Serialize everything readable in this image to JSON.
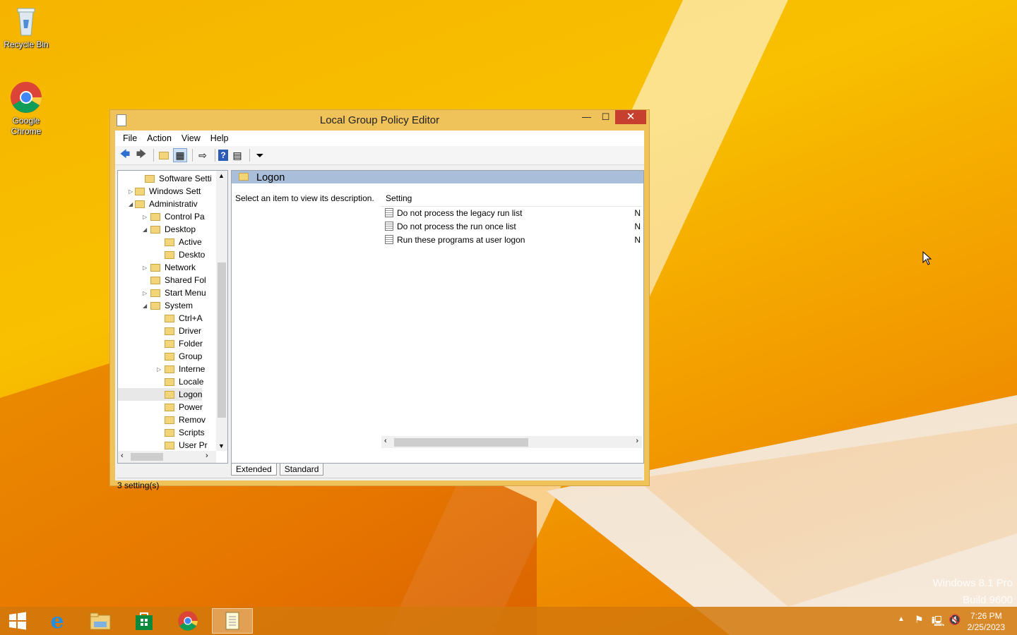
{
  "desktop": {
    "icons": [
      {
        "label": "Recycle Bin"
      },
      {
        "label": "Google Chrome"
      }
    ],
    "watermark": {
      "line1": "Windows 8.1 Pro",
      "line2": "Build 9600"
    }
  },
  "window": {
    "title": "Local Group Policy Editor",
    "menu": [
      "File",
      "Action",
      "View",
      "Help"
    ],
    "tree": [
      {
        "label": "Software Setti",
        "expander": ""
      },
      {
        "label": "Windows Sett",
        "expander": "▷"
      },
      {
        "label": "Administrativ",
        "expander": "◢"
      },
      {
        "label": "Control Pa",
        "expander": "▷"
      },
      {
        "label": "Desktop",
        "expander": "◢"
      },
      {
        "label": "Active",
        "expander": ""
      },
      {
        "label": "Deskto",
        "expander": ""
      },
      {
        "label": "Network",
        "expander": "▷"
      },
      {
        "label": "Shared Fol",
        "expander": ""
      },
      {
        "label": "Start Menu",
        "expander": "▷"
      },
      {
        "label": "System",
        "expander": "◢"
      },
      {
        "label": "Ctrl+A",
        "expander": ""
      },
      {
        "label": "Driver",
        "expander": ""
      },
      {
        "label": "Folder",
        "expander": ""
      },
      {
        "label": "Group",
        "expander": ""
      },
      {
        "label": "Interne",
        "expander": "▷"
      },
      {
        "label": "Locale",
        "expander": ""
      },
      {
        "label": "Logon",
        "expander": ""
      },
      {
        "label": "Power",
        "expander": ""
      },
      {
        "label": "Remov",
        "expander": ""
      },
      {
        "label": "Scripts",
        "expander": ""
      },
      {
        "label": "User Pr",
        "expander": ""
      }
    ],
    "detail": {
      "title": "Logon",
      "description": "Select an item to view its description.",
      "column_setting": "Setting",
      "rows": [
        {
          "name": "Do not process the legacy run list",
          "state": "N"
        },
        {
          "name": "Do not process the run once list",
          "state": "N"
        },
        {
          "name": "Run these programs at user logon",
          "state": "N"
        }
      ]
    },
    "tabs": [
      "Extended",
      "Standard"
    ],
    "status": "3 setting(s)"
  },
  "taskbar": {
    "time": "7:26 PM",
    "date": "2/25/2023"
  }
}
